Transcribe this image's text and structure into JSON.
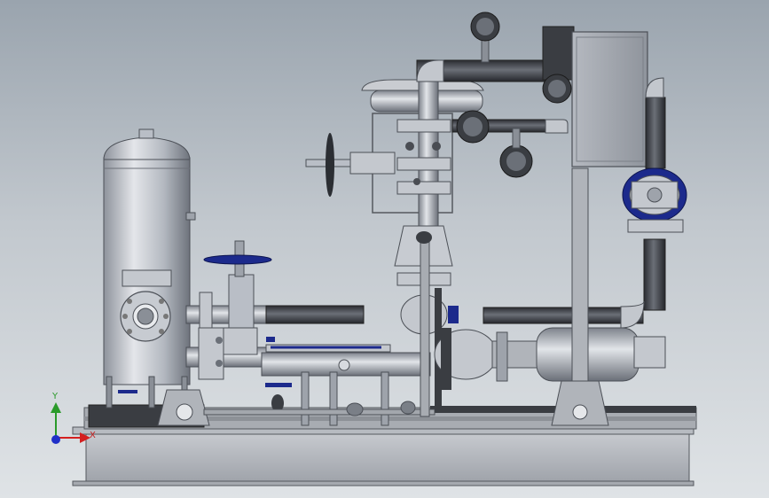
{
  "viewport": {
    "background_top": "#9aa4ae",
    "background_bottom": "#dfe3e6"
  },
  "model": {
    "colors": {
      "steel": "#b9bec6",
      "steel_dark": "#6f7580",
      "pipe_dark": "#3c3f45",
      "handwheel": "#2b2e33",
      "blue_handle": "#1c2a8c",
      "frame": "#aeb2b8"
    },
    "components": [
      "vertical-tank",
      "base-frame",
      "gate-valve",
      "control-valve",
      "pump",
      "electrical-cabinet",
      "pressure-gauge",
      "manifold-pipe",
      "butterfly-valve"
    ]
  },
  "triad": {
    "x_label": "X",
    "y_label": "Y",
    "x_color": "#d42020",
    "y_color": "#2a9a2a",
    "z_color": "#2030c8"
  }
}
